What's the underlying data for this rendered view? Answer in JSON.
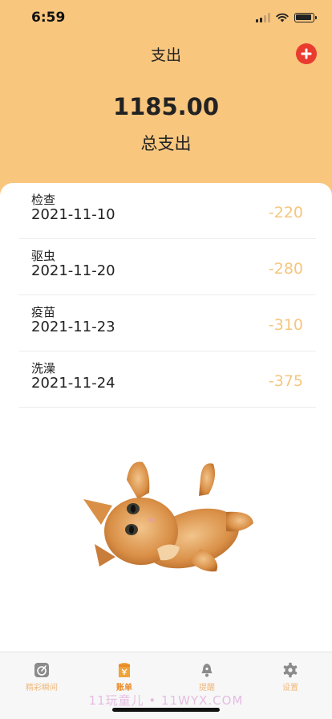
{
  "status_bar": {
    "time": "6:59"
  },
  "header": {
    "title": "支出",
    "add_icon": "plus-circle-icon"
  },
  "summary": {
    "total_amount": "1185.00",
    "total_label": "总支出"
  },
  "expenses": [
    {
      "title": "检查",
      "date": "2021-11-10",
      "amount": "-220"
    },
    {
      "title": "驱虫",
      "date": "2021-11-20",
      "amount": "-280"
    },
    {
      "title": "疫苗",
      "date": "2021-11-23",
      "amount": "-310"
    },
    {
      "title": "洗澡",
      "date": "2021-11-24",
      "amount": "-375"
    }
  ],
  "tab_bar": {
    "tabs": [
      {
        "label": "精彩瞬间",
        "icon": "pencil-square-icon"
      },
      {
        "label": "账单",
        "icon": "bill-icon"
      },
      {
        "label": "提醒",
        "icon": "bell-icon"
      },
      {
        "label": "设置",
        "icon": "gear-icon"
      }
    ],
    "active_index": 1
  },
  "watermark": "11玩童儿 • 11WYX.COM",
  "colors": {
    "header": "#f9c67e",
    "amount": "#f5c67d",
    "add_button": "#ea3b2f",
    "tab_active": "#e98a28",
    "tab_inactive": "#f0b87a"
  }
}
